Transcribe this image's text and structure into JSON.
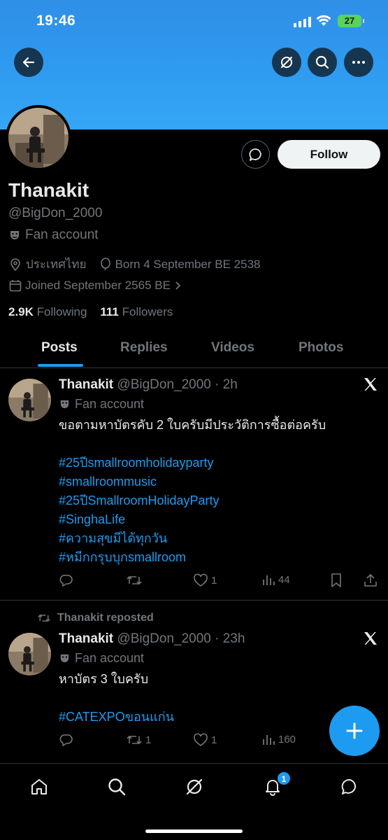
{
  "status_bar": {
    "time": "19:46",
    "battery": "27"
  },
  "profile": {
    "name": "Thanakit",
    "handle": "@BigDon_2000",
    "category": "Fan account",
    "location": "ประเทศไทย",
    "born": "Born 4 September BE 2538",
    "joined": "Joined September 2565 BE",
    "following_count": "2.9K",
    "following_label": "Following",
    "followers_count": "111",
    "followers_label": "Followers",
    "follow_button": "Follow"
  },
  "tabs": [
    {
      "label": "Posts",
      "active": true
    },
    {
      "label": "Replies",
      "active": false
    },
    {
      "label": "Videos",
      "active": false
    },
    {
      "label": "Photos",
      "active": false
    }
  ],
  "posts": [
    {
      "author": "Thanakit",
      "handle_time": "@BigDon_2000 · 2h",
      "category": "Fan account",
      "text": "ขอตามหาบัตรคับ 2 ใบครับมีประวัติการซื้อต่อครับ",
      "hashtags": [
        "#25ปีsmallroomholidayparty",
        "#smallroommusic",
        "#25ปีSmallroomHolidayParty",
        "#SinghaLife",
        "#ความสุขมีได้ทุกวัน",
        "#หมีกกรุบบุกsmallroom"
      ],
      "replies": "",
      "reposts": "",
      "likes": "1",
      "views": "44"
    },
    {
      "repost_label": "Thanakit reposted",
      "author": "Thanakit",
      "handle_time": "@BigDon_2000 · 23h",
      "category": "Fan account",
      "text": "หาบัตร 3 ใบครับ",
      "hashtags": [
        "#CATEXPOขอนแก่น"
      ],
      "replies": "",
      "reposts": "1",
      "likes": "1",
      "views": "160"
    }
  ],
  "notifications_badge": "1",
  "colors": {
    "accent": "#1d9bf0",
    "banner": "#2e9af0",
    "muted": "#71767b"
  }
}
